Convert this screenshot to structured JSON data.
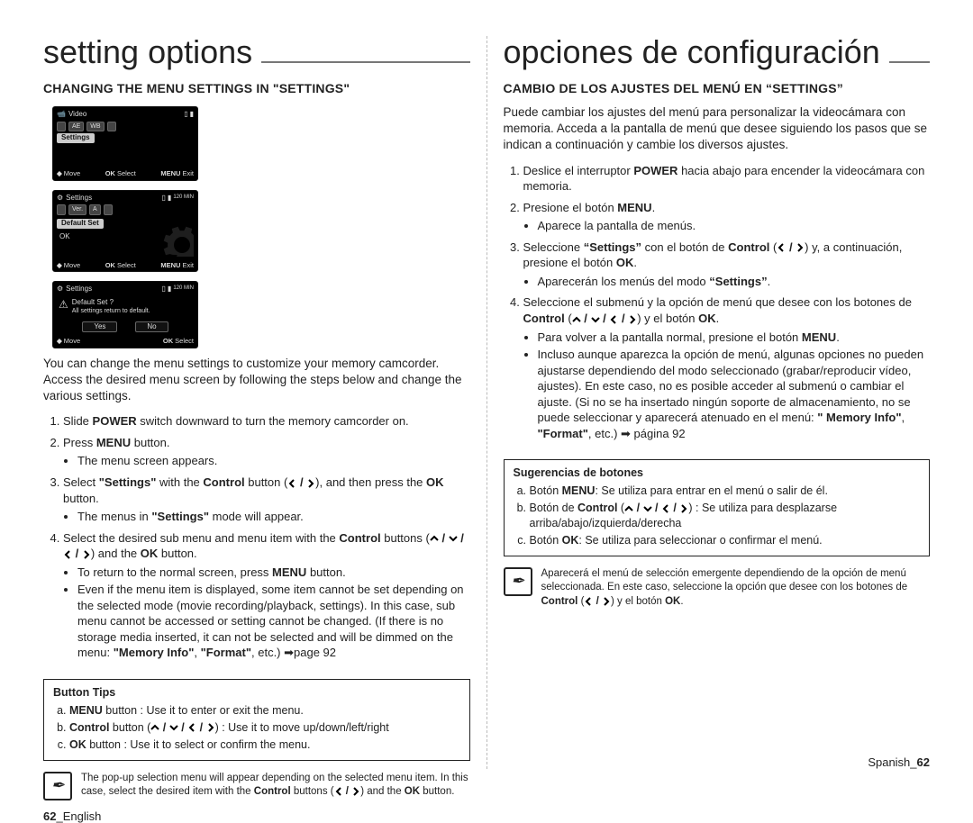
{
  "left": {
    "title": "setting options",
    "heading": "CHANGING THE MENU SETTINGS IN \"SETTINGS\"",
    "intro_full": "You can change the menu settings to customize your memory camcorder.  Access the desired menu screen by following the steps below and change the various settings.",
    "steps": {
      "s1": "Slide <b>POWER</b> switch downward to turn the memory camcorder on.",
      "s2": "Press <b>MENU</b> button.",
      "s2b": "The menu screen appears.",
      "s3a": "Select <b>\"Settings\"</b> with the <b>Control</b> button (",
      "s3b": "), and then press the <b>OK</b> button.",
      "s3c": "The menus in <b>\"Settings\"</b> mode will appear.",
      "s4a": "Select the desired sub menu and menu item with the <b>Control</b> buttons (",
      "s4b": ") and the <b>OK</b> button.",
      "s4c": "To return to the normal screen, press <b>MENU</b> button.",
      "s4d": "Even if the menu item is displayed, some item cannot be set depending on the selected mode (movie recording/playback, settings). In this case, sub menu cannot be accessed or setting cannot be changed. (If there is no storage media inserted, it can not be selected and will be dimmed on the menu: <b>\"Memory Info\"</b>, <b>\"Format\"</b>, etc.) ➡page 92"
    },
    "tips": {
      "title": "Button Tips",
      "a": "<b>MENU</b> button : Use it to enter or exit the menu.",
      "b_pre": "<b>Control</b> button (",
      "b_post": ") : Use it to move up/down/left/right",
      "c": "<b>OK</b> button : Use it to select or confirm the menu."
    },
    "note_pre": "The pop-up selection menu will appear depending on the selected menu item. In this case, select the desired item with the <b>Control</b> buttons (",
    "note_post": ") and the <b>OK</b> button.",
    "footer": "English",
    "page": "62"
  },
  "right": {
    "title": "opciones de configuración",
    "heading": "CAMBIO DE LOS AJUSTES DEL MENÚ EN “SETTINGS”",
    "intro_full": "Puede cambiar los ajustes del menú para personalizar la videocámara con memoria. Acceda a la pantalla de menú que desee siguiendo los pasos que se indican a continuación y cambie los diversos ajustes.",
    "steps": {
      "s1": "Deslice el interruptor <b>POWER</b> hacia abajo para encender la videocámara con memoria.",
      "s2": "Presione el botón <b>MENU</b>.",
      "s2b": "Aparece la pantalla de menús.",
      "s3a": "Seleccione <b>“Settings”</b> con el botón de <b>Control</b> (",
      "s3b": ") y, a continuación, presione el botón <b>OK</b>.",
      "s3c": "Aparecerán los menús del modo <b>“Settings”</b>.",
      "s4a": "Seleccione el submenú y la opción de menú que desee con los botones de <b>Control</b> (",
      "s4b": ") y el botón <b>OK</b>.",
      "s4c": "Para volver a la pantalla normal, presione el botón <b>MENU</b>.",
      "s4d": "Incluso aunque aparezca la opción de menú, algunas opciones no pueden ajustarse dependiendo del modo seleccionado (grabar/reproducir vídeo, ajustes). En este caso, no es posible acceder al submenú o cambiar el ajuste. (Si no se ha insertado ningún soporte de almacenamiento, no se puede seleccionar y aparecerá atenuado en el menú: <b>\" Memory Info\"</b>, <b>\"Format\"</b>, etc.) ➡ página 92"
    },
    "tips": {
      "title": "Sugerencias de botones",
      "a": "Botón <b>MENU</b>: Se utiliza para entrar en el menú o salir de él.",
      "b_pre": "Botón de <b>Control</b> (",
      "b_post": ") : Se utiliza para desplazarse arriba/abajo/izquierda/derecha",
      "c": "Botón <b>OK</b>: Se utiliza para seleccionar o confirmar el menú."
    },
    "note_pre": "Aparecerá el menú de selección emergente dependiendo de la opción de menú seleccionada. En este caso, seleccione la opción que desee con los botones de <b>Control</b> (",
    "note_post": ") y el botón <b>OK</b>.",
    "footer": "Spanish",
    "page": "62"
  },
  "screens": {
    "s1": {
      "title": "Video",
      "row": [
        "AE",
        "WB"
      ],
      "hover": "Settings",
      "bot_move": "Move",
      "bot_select": "Select",
      "bot_exit": "Exit"
    },
    "s2": {
      "title": "Settings",
      "row": [
        "Ver.",
        "A"
      ],
      "hover": "Default Set",
      "opt": "OK",
      "bot_move": "Move",
      "bot_select": "Select",
      "bot_exit": "Exit"
    },
    "s3": {
      "title": "Settings",
      "q1": "Default Set ?",
      "q2": "All settings return to default.",
      "yes": "Yes",
      "no": "No",
      "bot_move": "Move",
      "bot_select": "Select"
    }
  },
  "glyphs": {
    "note_icon": "✒",
    "cam_icon": "📹",
    "gear_icon": "⚙",
    "warn_icon": "⚠",
    "card_icon": "▯",
    "bat_icon": "▮",
    "menu_label": "MENU",
    "ok_label": "OK",
    "min_label": "120 MIN"
  }
}
